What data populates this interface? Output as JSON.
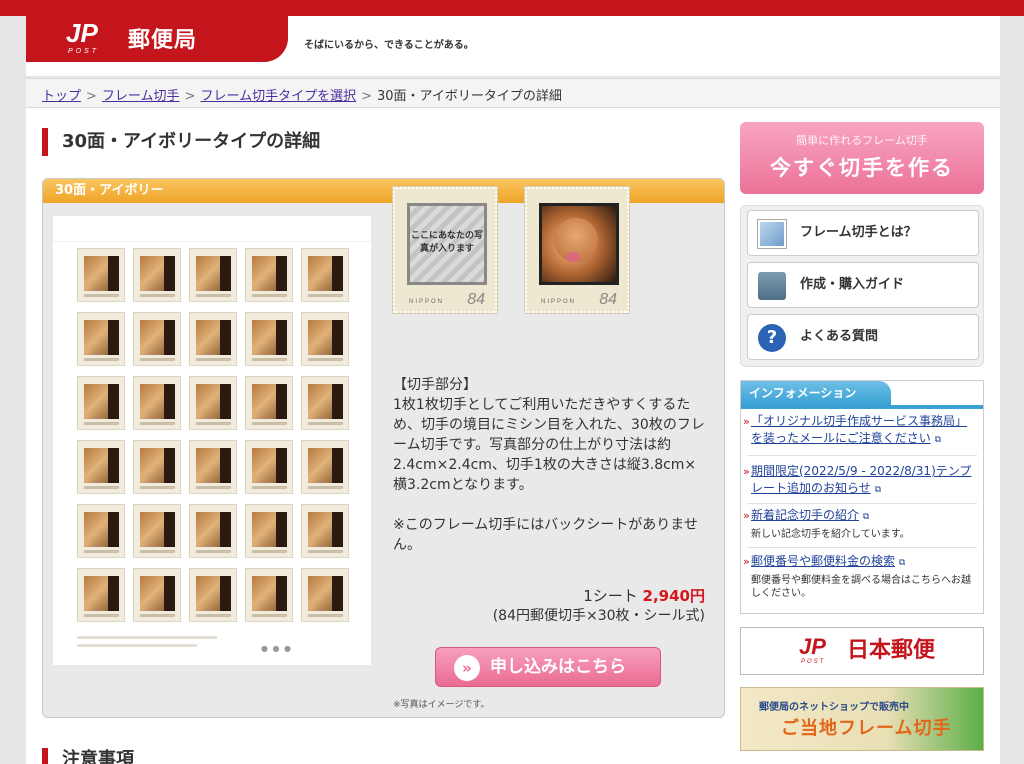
{
  "header": {
    "logo_mark": "JP",
    "logo_post": "POST",
    "logo_text": "郵便局",
    "tagline": "そばにいるから、できることがある。"
  },
  "breadcrumb": {
    "items": [
      "トップ",
      "フレーム切手",
      "フレーム切手タイプを選択"
    ],
    "separator": ">",
    "current": "30面・アイボリータイプの詳細"
  },
  "main": {
    "title": "30面・アイボリータイプの詳細",
    "panel_title": "30面・アイボリー",
    "stamp_placeholder_text": "ここにあなたの写真が入ります",
    "stamp_nippon": "NIPPON",
    "stamp_denomination": "84",
    "desc_heading": "【切手部分】",
    "desc_body": "1枚1枚切手としてご利用いただきやすくするため、切手の境目にミシン目を入れた、30枚のフレーム切手です。写真部分の仕上がり寸法は約 2.4cm×2.4cm、切手1枚の大きさは縦3.8cm×横3.2cmとなります。",
    "desc_note": "※このフレーム切手にはバックシートがありません。",
    "price_prefix": "1シート",
    "price": "2,940円",
    "price_detail": "(84円郵便切手×30枚・シール式)",
    "apply_button": "申し込みはこちら",
    "apply_icon": "double-chevron-icon",
    "image_note": "※写真はイメージです。",
    "section2_title": "注意事項"
  },
  "sidebar": {
    "make_sub": "簡単に作れるフレーム切手",
    "make_main": "今すぐ切手を作る",
    "menu": [
      {
        "label": "フレーム切手とは？",
        "icon": "photo-icon"
      },
      {
        "label": "作成・購入ガイド",
        "icon": "guide-book-icon"
      },
      {
        "label": "よくある質問",
        "icon": "question-icon",
        "icon_glyph": "?"
      }
    ],
    "info_title": "インフォメーション",
    "info_items": [
      {
        "link": "「オリジナル切手作成サービス事務局」を装ったメールにご注意ください",
        "note": ""
      },
      {
        "link": "期間限定(2022/5/9 - 2022/8/31)テンプレート追加のお知らせ",
        "note": ""
      },
      {
        "link": "新着記念切手の紹介",
        "note": "新しい記念切手を紹介しています。"
      },
      {
        "link": "郵便番号や郵便料金の検索",
        "note": "郵便番号や郵便料金を調べる場合はこちらへお越しください。"
      }
    ],
    "jpost_mark": "JP",
    "jpost_post": "POST",
    "jpost_name": "日本郵便",
    "shop_line1": "郵便局のネットショップで販売中",
    "shop_line2": "ご当地フレーム切手"
  },
  "colors": {
    "brand_red": "#c4151c",
    "panel_orange": "#f0a52a",
    "button_pink": "#ec7298",
    "link_blue": "#21449b",
    "info_blue": "#3aa1d4",
    "price_red": "#d4171d"
  }
}
